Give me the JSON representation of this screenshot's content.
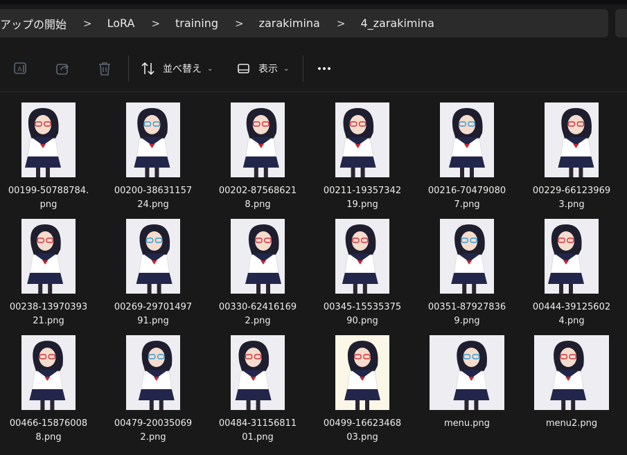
{
  "breadcrumb": {
    "items": [
      "アップの開始",
      "LoRA",
      "training",
      "zarakimina",
      "4_zarakimina"
    ],
    "separator": ">"
  },
  "toolbar": {
    "rename_icon": "rename-icon",
    "share_icon": "share-icon",
    "delete_icon": "trash-icon",
    "sort_label": "並べ替え",
    "view_label": "表示",
    "more_icon": "more-icon"
  },
  "files": [
    {
      "line1": "00199-50788784.",
      "line2": "png"
    },
    {
      "line1": "00200-38631157",
      "line2": "24.png"
    },
    {
      "line1": "00202-87568621",
      "line2": "8.png"
    },
    {
      "line1": "00211-19357342",
      "line2": "19.png"
    },
    {
      "line1": "00216-70479080",
      "line2": "7.png"
    },
    {
      "line1": "00229-66123969",
      "line2": "3.png"
    },
    {
      "line1": "00238-13970393",
      "line2": "21.png"
    },
    {
      "line1": "00269-29701497",
      "line2": "91.png"
    },
    {
      "line1": "00330-62416169",
      "line2": "2.png"
    },
    {
      "line1": "00345-15535375",
      "line2": "90.png"
    },
    {
      "line1": "00351-87927836",
      "line2": "9.png"
    },
    {
      "line1": "00444-39125602",
      "line2": "4.png"
    },
    {
      "line1": "00466-15876008",
      "line2": "8.png"
    },
    {
      "line1": "00479-20035069",
      "line2": "2.png"
    },
    {
      "line1": "00484-31156811",
      "line2": "01.png"
    },
    {
      "line1": "00499-16623468",
      "line2": "03.png"
    },
    {
      "line1": "menu.png",
      "line2": ""
    },
    {
      "line1": "menu2.png",
      "line2": ""
    }
  ],
  "colors": {
    "background": "#191919",
    "address_bar": "#2b2b2b",
    "hair": "#1e1e2e",
    "uniform_navy": "#22264a",
    "ribbon_red": "#c8242c",
    "glasses_red": "#d0303a",
    "glasses_blue": "#2d9bd8"
  }
}
